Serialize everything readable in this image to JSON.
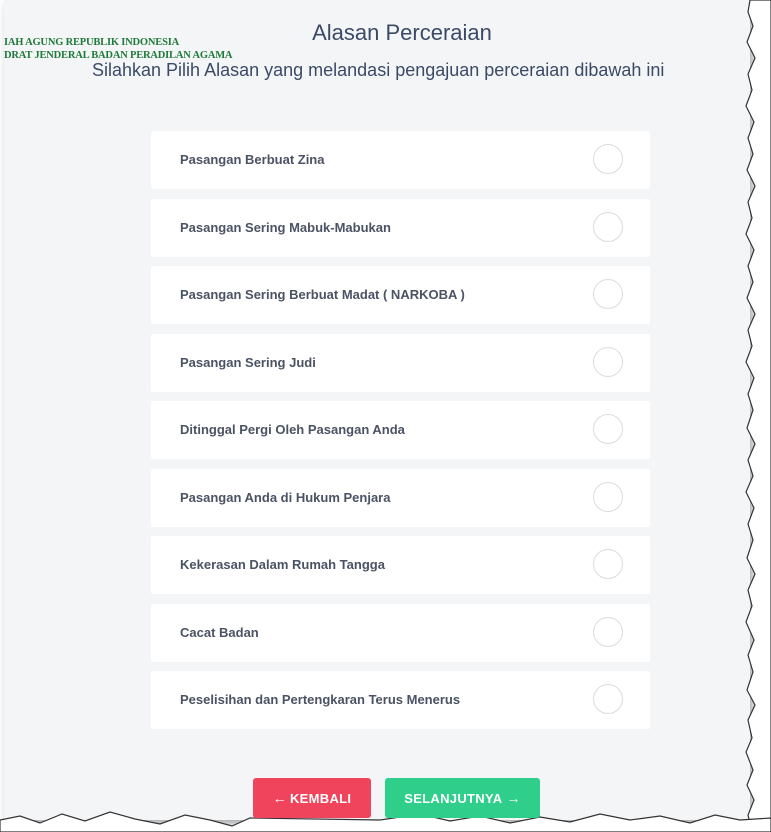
{
  "watermark": {
    "line1": "IAH AGUNG REPUBLIK INDONESIA",
    "line2": "DRAT JENDERAL BADAN PERADILAN AGAMA"
  },
  "header": {
    "title": "Alasan Perceraian",
    "subtitle": "Silahkan Pilih Alasan yang melandasi pengajuan perceraian dibawah ini"
  },
  "options": [
    {
      "label": "Pasangan Berbuat Zina",
      "selected": false
    },
    {
      "label": "Pasangan Sering Mabuk-Mabukan",
      "selected": false
    },
    {
      "label": "Pasangan Sering Berbuat Madat ( NARKOBA )",
      "selected": false
    },
    {
      "label": "Pasangan Sering Judi",
      "selected": false
    },
    {
      "label": "Ditinggal Pergi Oleh Pasangan Anda",
      "selected": false
    },
    {
      "label": "Pasangan Anda di Hukum Penjara",
      "selected": false
    },
    {
      "label": "Kekerasan Dalam Rumah Tangga",
      "selected": false
    },
    {
      "label": "Cacat Badan",
      "selected": false
    },
    {
      "label": "Peselisihan dan Pertengkaran Terus Menerus",
      "selected": false
    }
  ],
  "buttons": {
    "back_label": "KEMBALI",
    "back_icon": "arrow-left-icon",
    "next_label": "SELANJUTNYA",
    "next_icon": "arrow-right-icon"
  },
  "colors": {
    "back_button": "#f0445c",
    "next_button": "#2fce8a",
    "watermark": "#1f7a3a",
    "panel_background": "#f4f5f7"
  }
}
